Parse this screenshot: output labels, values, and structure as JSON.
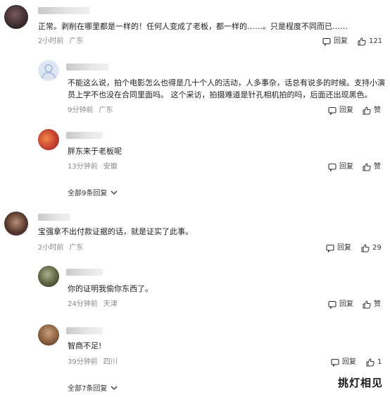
{
  "comments": [
    {
      "text": "正常。剥削在哪里都是一样的！任何人变成了老板，都一样的……。只是程度不同而已……",
      "time": "2小时前",
      "location": "广东",
      "reply_label": "回复",
      "like_count": "121"
    },
    {
      "text_line1": "不能这么说，拍个电影怎么也得是几十个人的活动，人多事杂，话总有说多的时候。支持小演",
      "text_line2": "员上学不也没在合同里面吗。 这个采访，拍摄难道是针孔相机拍的吗，后面还出现黑色。",
      "time": "9分钟前",
      "location": "广东",
      "reply_label": "回复",
      "like_label": "赞"
    },
    {
      "text": "胖东来于老板呢",
      "time": "13分钟前",
      "location": "安徽",
      "reply_label": "回复",
      "like_label": "赞"
    },
    {
      "text": "宝强拿不出付款证据的话，就是证实了此事。",
      "time": "2小时前",
      "location": "广东",
      "reply_label": "回复",
      "like_count": "29"
    },
    {
      "text": "你的证明我偷你东西了。",
      "time": "24分钟前",
      "location": "天津",
      "reply_label": "回复",
      "like_label": "赞"
    },
    {
      "text": "智商不足!",
      "time": "39分钟前",
      "location": "四川",
      "reply_label": "回复",
      "like_count": "1"
    }
  ],
  "expand_replies_1": "全部9条回复",
  "expand_replies_2": "全部7条回复",
  "watermark": "挑灯相见"
}
